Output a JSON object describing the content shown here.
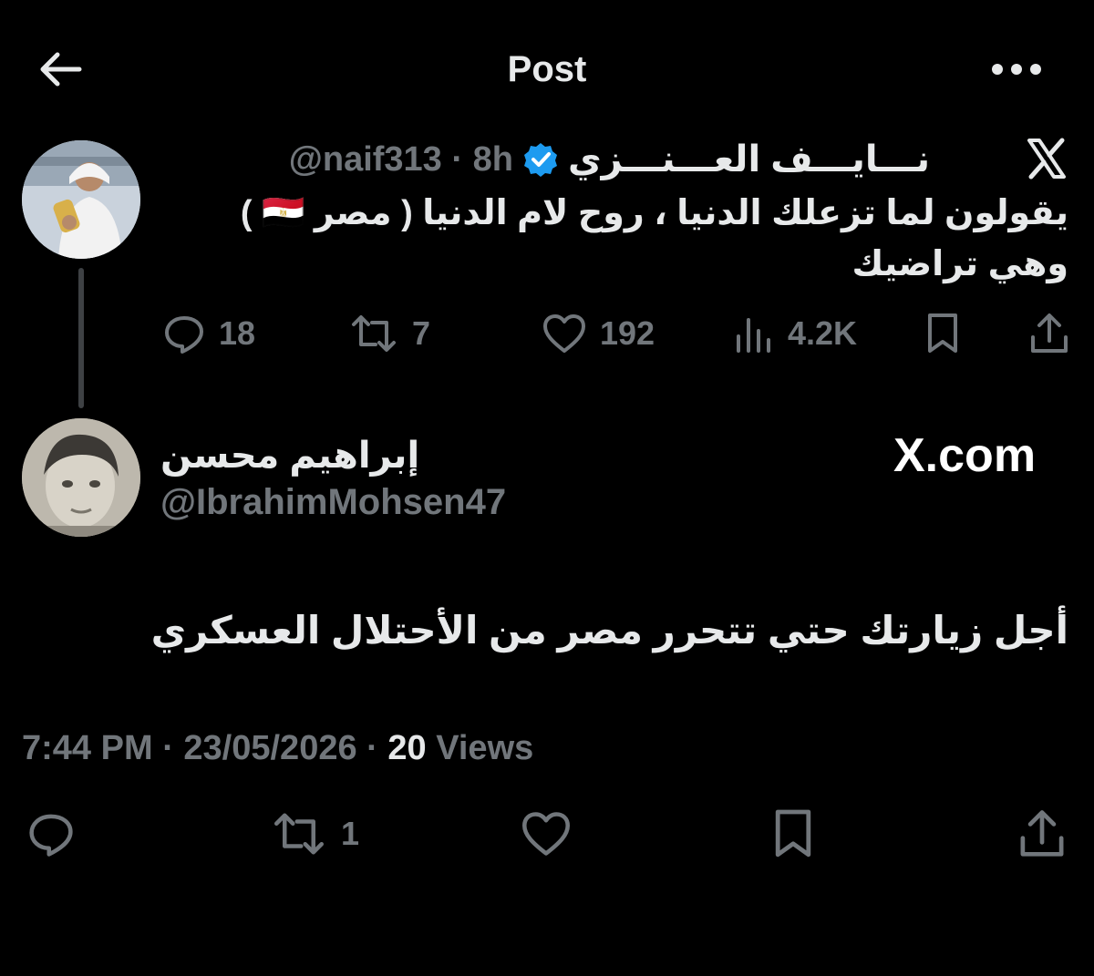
{
  "header": {
    "title": "Post",
    "back_icon": "arrow-left-icon",
    "more_icon": "more-horizontal-icon"
  },
  "quoted_tweet": {
    "author_name": "نـــايـــف العـــنـــزي",
    "verified": true,
    "handle": "@naif313",
    "time": "· 8h",
    "text_line1": "يقولون لما تزعلك الدنيا ، روح لام الدنيا ( مصر 🇪🇬 )",
    "text_line2": "وهي تراضيك",
    "replies": "18",
    "reposts": "7",
    "likes": "192",
    "views": "4.2K"
  },
  "reply": {
    "author_name": "إبراهيم محسن",
    "handle": "@IbrahimMohsen47",
    "watermark": "X.com",
    "text": "أجل زيارتك حتي تتحرر مصر من الأحتلال العسكري",
    "time": "7:44 PM",
    "date": "23/05/2026",
    "views_count": "20",
    "views_label": "Views",
    "reposts": "1"
  },
  "colors": {
    "background": "#000000",
    "primary_text": "#e7e9ea",
    "secondary_text": "#71767b",
    "verified_blue": "#1d9bf0"
  }
}
